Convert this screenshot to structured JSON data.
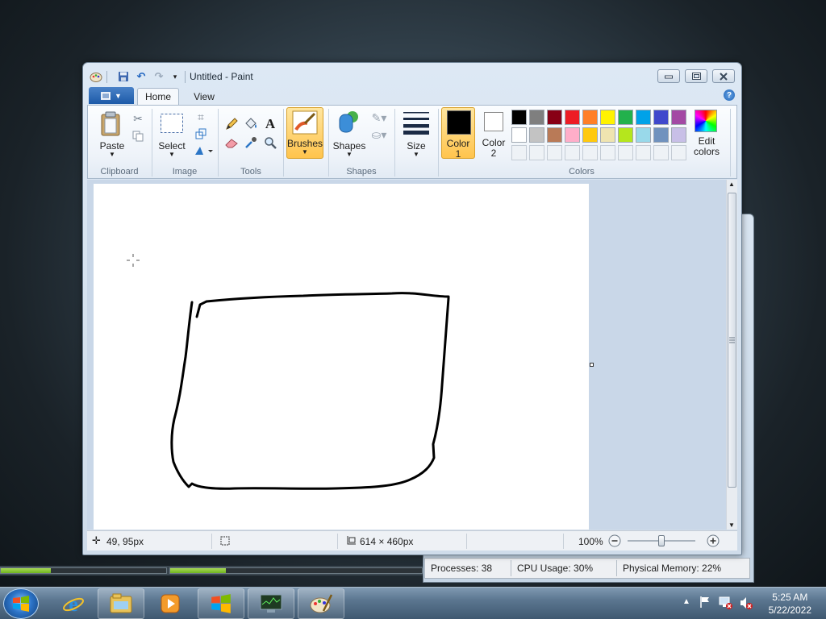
{
  "window": {
    "title": "Untitled - Paint"
  },
  "ribbon": {
    "tabs": [
      {
        "label": "Home",
        "active": true
      },
      {
        "label": "View",
        "active": false
      }
    ],
    "groups": {
      "clipboard": {
        "label": "Clipboard",
        "paste_label": "Paste"
      },
      "image": {
        "label": "Image",
        "select_label": "Select"
      },
      "tools": {
        "label": "Tools"
      },
      "brushes": {
        "label": "Brushes"
      },
      "shapes": {
        "label": "Shapes",
        "shapes_label": "Shapes"
      },
      "size": {
        "label": "Size"
      },
      "colors": {
        "label": "Colors",
        "color1_line1": "Color",
        "color1_line2": "1",
        "color2_line1": "Color",
        "color2_line2": "2",
        "edit_line1": "Edit",
        "edit_line2": "colors",
        "color1": "#000000",
        "color2": "#ffffff",
        "palette_row1": [
          "#000000",
          "#7f7f7f",
          "#880015",
          "#ed1c24",
          "#ff7f27",
          "#fff200",
          "#22b14c",
          "#00a2e8",
          "#3f48cc",
          "#a349a4"
        ],
        "palette_row2": [
          "#ffffff",
          "#c3c3c3",
          "#b97a57",
          "#ffaec9",
          "#ffc90e",
          "#efe4b0",
          "#b5e61d",
          "#99d9ea",
          "#7092be",
          "#c8bfe7"
        ]
      }
    }
  },
  "statusbar": {
    "cursor_position": "49, 95px",
    "canvas_size": "614 × 460px",
    "zoom": "100%"
  },
  "taskmanager": {
    "processes": "Processes: 38",
    "cpu": "CPU Usage: 30%",
    "memory": "Physical Memory: 22%",
    "cpu_fraction": 0.3,
    "memory_fraction": 0.22
  },
  "taskbar": {
    "time": "5:25 AM",
    "date": "5/22/2022",
    "pinned": [
      "start-orb",
      "internet-explorer",
      "windows-explorer",
      "windows-media-player",
      "windows-update",
      "task-manager",
      "paint"
    ]
  }
}
